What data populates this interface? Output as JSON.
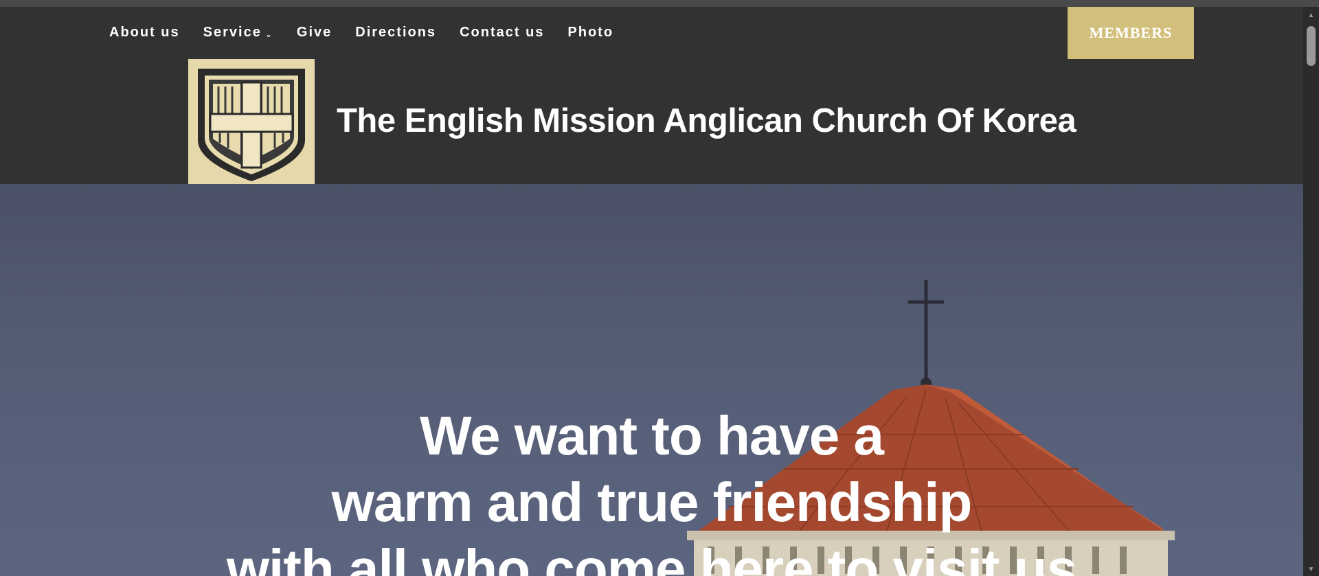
{
  "nav": {
    "items": [
      {
        "label": "About us"
      },
      {
        "label": "Service",
        "has_dropdown": true,
        "chevron": "⌄"
      },
      {
        "label": "Give"
      },
      {
        "label": "Directions"
      },
      {
        "label": "Contact us"
      },
      {
        "label": "Photo"
      }
    ]
  },
  "members_button": {
    "label": "MEMBERS",
    "color": "#d2bf7c"
  },
  "site": {
    "title": "The English Mission Anglican Church Of Korea",
    "logo_icon": "shield-cross-icon"
  },
  "hero": {
    "lines": [
      "We want to have a",
      "warm and true friendship",
      "with all who come here to visit us"
    ],
    "image": "church-roof-with-cross"
  },
  "scrollbar": {
    "up_glyph": "▲",
    "down_glyph": "▼"
  },
  "colors": {
    "header_bg": "#323232",
    "accent": "#d2bf7c",
    "text": "#ffffff"
  }
}
